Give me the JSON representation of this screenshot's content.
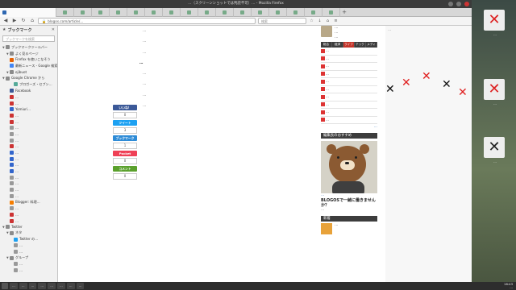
{
  "window": {
    "title": "…（スクリーンショットでは判読不可）… - Mozilla Firefox",
    "tabs_count": 17
  },
  "navbar": {
    "url": "blogos.com/article/…",
    "search_placeholder": "検索"
  },
  "sidebar": {
    "title": "ブックマーク",
    "search_placeholder": "ブックマークを検索",
    "items": [
      {
        "label": "ブックマークツールバー",
        "kind": "folder",
        "color": "#8b8b8b",
        "indent": 0
      },
      {
        "label": "よく見るページ",
        "kind": "folder",
        "color": "#8b8b8b",
        "indent": 1
      },
      {
        "label": "Firefox を使いこなそう",
        "kind": "link",
        "color": "#e66000",
        "indent": 1
      },
      {
        "label": "最新ニュース - Google 検索",
        "kind": "link",
        "color": "#4285f4",
        "indent": 1
      },
      {
        "label": "ojibuot",
        "kind": "folder",
        "color": "#8b8b8b",
        "indent": 1
      },
      {
        "label": "Google Chrome から",
        "kind": "folder",
        "color": "#8b8b8b",
        "indent": 0
      },
      {
        "label": "ブロガーズ・セブン…",
        "kind": "link",
        "color": "#5a9",
        "indent": 2
      },
      {
        "label": "Facebook",
        "kind": "link",
        "color": "#3b5998",
        "indent": 1
      },
      {
        "label": "…",
        "kind": "link",
        "color": "#c33",
        "indent": 1
      },
      {
        "label": "…",
        "kind": "link",
        "color": "#c33",
        "indent": 1
      },
      {
        "label": "Yomiuri…",
        "kind": "link",
        "color": "#36c",
        "indent": 1
      },
      {
        "label": "…",
        "kind": "link",
        "color": "#c33",
        "indent": 1
      },
      {
        "label": "…",
        "kind": "link",
        "color": "#c33",
        "indent": 1
      },
      {
        "label": "…",
        "kind": "link",
        "color": "#999",
        "indent": 1
      },
      {
        "label": "…",
        "kind": "link",
        "color": "#999",
        "indent": 1
      },
      {
        "label": "…",
        "kind": "link",
        "color": "#999",
        "indent": 1
      },
      {
        "label": "…",
        "kind": "link",
        "color": "#c33",
        "indent": 1
      },
      {
        "label": "…",
        "kind": "link",
        "color": "#36c",
        "indent": 1
      },
      {
        "label": "…",
        "kind": "link",
        "color": "#36c",
        "indent": 1
      },
      {
        "label": "…",
        "kind": "link",
        "color": "#36c",
        "indent": 1
      },
      {
        "label": "…",
        "kind": "link",
        "color": "#36c",
        "indent": 1
      },
      {
        "label": "…",
        "kind": "link",
        "color": "#999",
        "indent": 1
      },
      {
        "label": "…",
        "kind": "link",
        "color": "#999",
        "indent": 1
      },
      {
        "label": "…",
        "kind": "link",
        "color": "#999",
        "indent": 1
      },
      {
        "label": "…",
        "kind": "link",
        "color": "#999",
        "indent": 1
      },
      {
        "label": "Blogger: 料理…",
        "kind": "link",
        "color": "#f57d00",
        "indent": 1
      },
      {
        "label": "…",
        "kind": "link",
        "color": "#999",
        "indent": 1
      },
      {
        "label": "…",
        "kind": "link",
        "color": "#c33",
        "indent": 1
      },
      {
        "label": "…",
        "kind": "link",
        "color": "#c33",
        "indent": 1
      },
      {
        "label": "Twitter",
        "kind": "folder",
        "color": "#8b8b8b",
        "indent": 0
      },
      {
        "label": "ネタ",
        "kind": "folder",
        "color": "#8b8b8b",
        "indent": 1
      },
      {
        "label": "Twitter の…",
        "kind": "link",
        "color": "#1da1f2",
        "indent": 2
      },
      {
        "label": "…",
        "kind": "link",
        "color": "#999",
        "indent": 2
      },
      {
        "label": "…",
        "kind": "link",
        "color": "#999",
        "indent": 2
      },
      {
        "label": "グループ",
        "kind": "folder",
        "color": "#8b8b8b",
        "indent": 1
      },
      {
        "label": "…",
        "kind": "link",
        "color": "#999",
        "indent": 2
      },
      {
        "label": "…",
        "kind": "link",
        "color": "#999",
        "indent": 2
      }
    ]
  },
  "share": {
    "buttons": [
      {
        "label": "いいね！",
        "color": "#3b5998"
      },
      {
        "label": "ツイート",
        "color": "#1da1f2"
      },
      {
        "label": "ブックマーク",
        "color": "#2e8bd6"
      }
    ],
    "counts": [
      "0",
      "3",
      "1"
    ],
    "pocket_label": "Pocket",
    "pocket_color": "#ef4056",
    "counts2": [
      "0"
    ],
    "comment_label": "コメント",
    "comment_color": "#5aa02c",
    "comment_count": "0"
  },
  "article": {
    "paragraphs": [
      {
        "text": "…",
        "kind": "p"
      },
      {
        "text": "…",
        "kind": "p"
      },
      {
        "text": "…",
        "kind": "p"
      },
      {
        "text": "…",
        "kind": "h"
      },
      {
        "text": "…",
        "kind": "p"
      },
      {
        "text": "…",
        "kind": "p"
      },
      {
        "text": "…",
        "kind": "p"
      },
      {
        "text": "…",
        "kind": "p"
      }
    ]
  },
  "rightcol": {
    "profile_lines": [
      "…",
      "…",
      "…"
    ],
    "tabs": [
      {
        "label": "総合",
        "on": false
      },
      {
        "label": "経済",
        "on": false
      },
      {
        "label": "ライフ",
        "on": true
      },
      {
        "label": "テック",
        "on": false
      },
      {
        "label": "メディア",
        "on": false
      }
    ],
    "ranking": [
      "…",
      "…",
      "…",
      "…",
      "…",
      "…",
      "…",
      "…",
      "…",
      "…"
    ],
    "more_label": "…",
    "editor_head": "編集長のおすすめ",
    "editor_link": "…",
    "editor_title": "BLOGOSで一緒に働きませんか？",
    "editor_sub": "…",
    "newnews_head": "新着",
    "news_text": "…"
  },
  "ad": {
    "title": "…",
    "colors": {
      "x_red": "#e02020",
      "x_black": "#111111"
    }
  },
  "taskbar": {
    "items": [
      "…",
      "…",
      "…",
      "…",
      "…",
      "…",
      "…",
      "…"
    ],
    "time": "16:43",
    "date": "…"
  },
  "desktop": {
    "labels": [
      "…",
      "…",
      "…"
    ]
  }
}
